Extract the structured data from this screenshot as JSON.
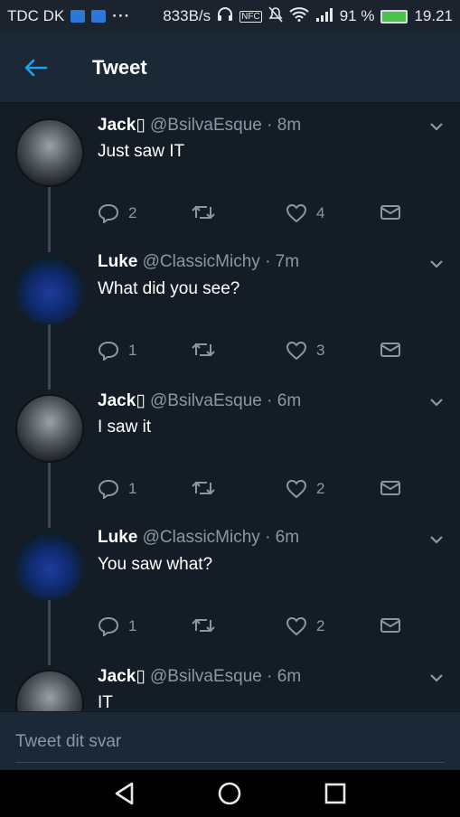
{
  "status_bar": {
    "carrier": "TDC DK",
    "dots": "···",
    "speed": "833B/s",
    "nfc": "NFC",
    "battery_percent": "91 %",
    "time": "19.21"
  },
  "header": {
    "title": "Tweet"
  },
  "tweets": [
    {
      "name": "Jack▯",
      "handle": "@BsilvaEsque",
      "time": "· 8m",
      "text": "Just saw IT",
      "replies": "2",
      "retweets": "",
      "likes": "4",
      "avatar": "jack"
    },
    {
      "name": "Luke",
      "handle": "@ClassicMichy",
      "time": "· 7m",
      "text": "What did you see?",
      "replies": "1",
      "retweets": "",
      "likes": "3",
      "avatar": "luke"
    },
    {
      "name": "Jack▯",
      "handle": "@BsilvaEsque",
      "time": "· 6m",
      "text": "I saw it",
      "replies": "1",
      "retweets": "",
      "likes": "2",
      "avatar": "jack"
    },
    {
      "name": "Luke",
      "handle": "@ClassicMichy",
      "time": "· 6m",
      "text": "You saw what?",
      "replies": "1",
      "retweets": "",
      "likes": "2",
      "avatar": "luke"
    },
    {
      "name": "Jack▯",
      "handle": "@BsilvaEsque",
      "time": "· 6m",
      "text": "IT",
      "replies": "",
      "retweets": "",
      "likes": "",
      "avatar": "jack"
    }
  ],
  "reply": {
    "placeholder": "Tweet dit svar"
  },
  "colors": {
    "accent": "#1da1f2",
    "background": "#141d26",
    "header": "#1b2836",
    "muted": "#8899a6"
  },
  "icons": {
    "back": "arrow-left-icon",
    "caret": "chevron-down-icon",
    "reply": "reply-icon",
    "retweet": "retweet-icon",
    "like": "heart-icon",
    "dm": "envelope-icon",
    "nav_back": "triangle-back-icon",
    "nav_home": "circle-home-icon",
    "nav_recent": "square-recents-icon"
  }
}
